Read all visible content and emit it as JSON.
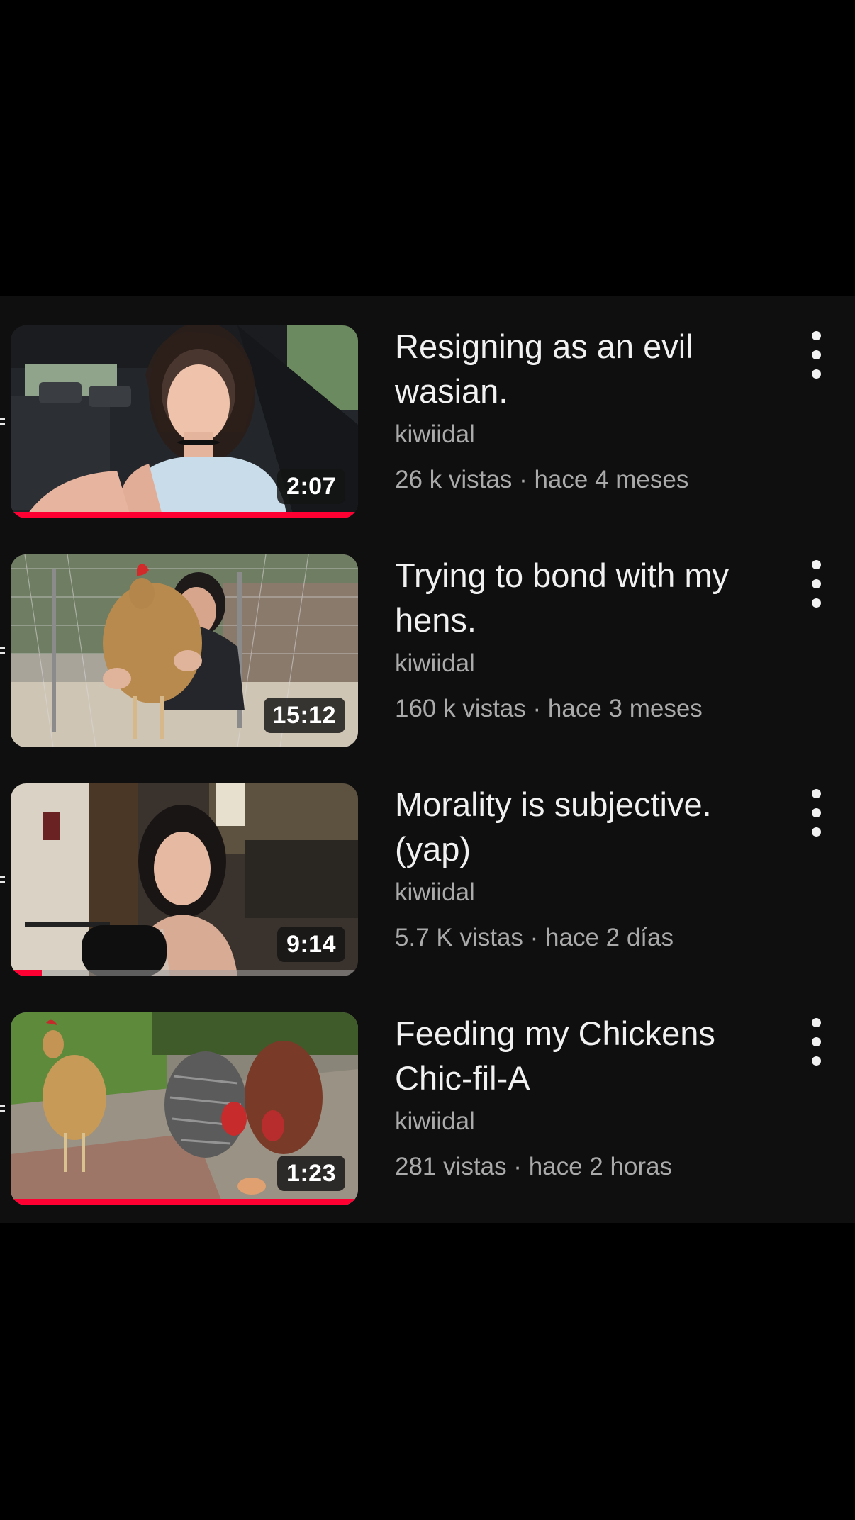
{
  "videos": [
    {
      "title": "Resigning as an evil wasian.",
      "channel": "kiwiidal",
      "meta": "26 k vistas · hace 4 meses",
      "duration": "2:07",
      "progress": 1.0,
      "thumbnail": "woman-in-car"
    },
    {
      "title": "Trying to bond with my hens.",
      "channel": "kiwiidal",
      "meta": "160 k vistas · hace 3 meses",
      "duration": "15:12",
      "progress": 0.0,
      "thumbnail": "woman-holding-hen"
    },
    {
      "title": "Morality is subjective. (yap)",
      "channel": "kiwiidal",
      "meta": "5.7 K vistas · hace 2 días",
      "duration": "9:14",
      "progress": 0.09,
      "thumbnail": "woman-with-microphone"
    },
    {
      "title": "Feeding my Chickens Chic-fil-A",
      "channel": "kiwiidal",
      "meta": "281 vistas · hace 2 horas",
      "duration": "1:23",
      "progress": 1.0,
      "thumbnail": "three-chickens"
    }
  ],
  "colors": {
    "background": "#0f0f0f",
    "title": "#f1f1f1",
    "secondary": "#aaaaaa",
    "progress": "#ff0033"
  }
}
